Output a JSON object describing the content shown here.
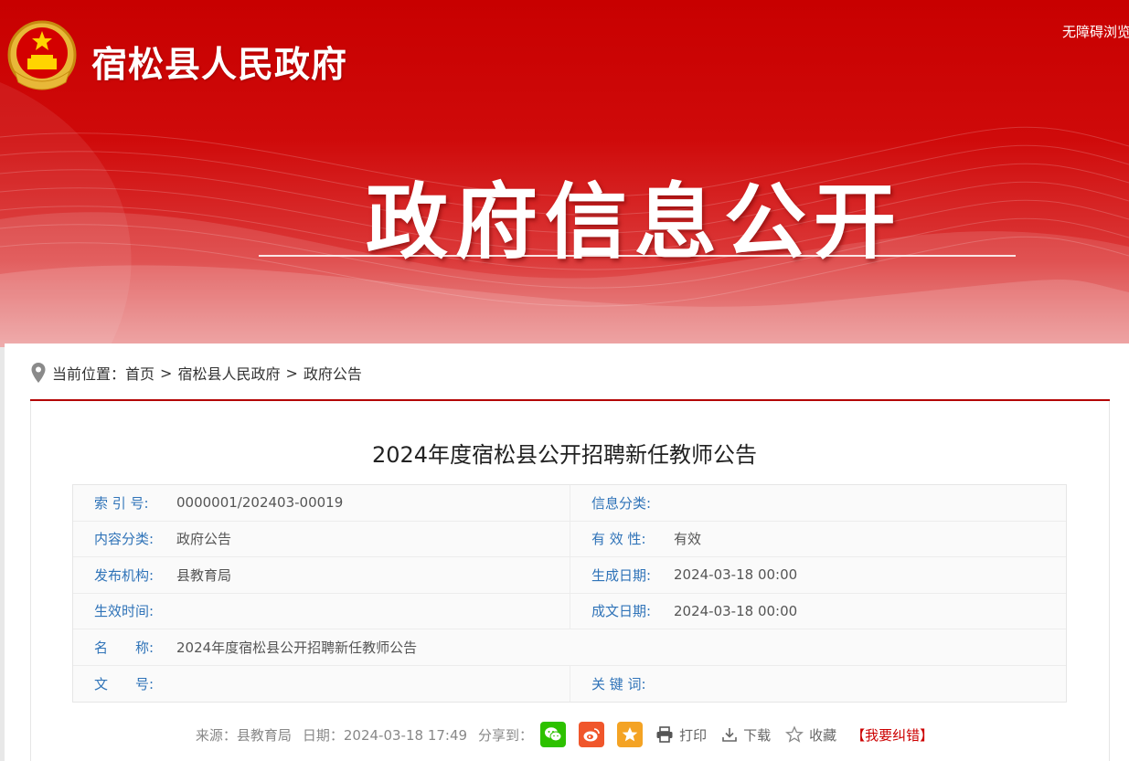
{
  "header": {
    "site_name": "宿松县人民政府",
    "accessibility_link": "无障碍浏览",
    "banner_title": "政府信息公开"
  },
  "breadcrumb": {
    "prefix": "当前位置：",
    "items": [
      "首页",
      "宿松县人民政府",
      "政府公告"
    ],
    "separator": ">"
  },
  "article": {
    "title": "2024年度宿松县公开招聘新任教师公告"
  },
  "info": {
    "index_label": "索 引 号:",
    "index_value": "0000001/202403-00019",
    "category_label": "信息分类:",
    "category_value": "",
    "content_type_label": "内容分类:",
    "content_type_value": "政府公告",
    "validity_label": "有 效 性:",
    "validity_value": "有效",
    "publisher_label": "发布机构:",
    "publisher_value": "县教育局",
    "created_label": "生成日期:",
    "created_value": "2024-03-18 00:00",
    "effective_label": "生效时间:",
    "effective_value": "",
    "written_label": "成文日期:",
    "written_value": "2024-03-18 00:00",
    "name_label": "名　　称:",
    "name_value": "2024年度宿松县公开招聘新任教师公告",
    "docno_label": "文　　号:",
    "docno_value": "",
    "keywords_label": "关 键 词:",
    "keywords_value": ""
  },
  "meta": {
    "source": "来源：县教育局",
    "date": "日期：2024-03-18 17:49",
    "share_label": "分享到：",
    "print_label": "打印",
    "download_label": "下载",
    "favorite_label": "收藏",
    "report_label": "【我要纠错】"
  },
  "colors": {
    "brand_red": "#c80000",
    "label_blue": "#2f73b8",
    "wechat_green": "#2dc100",
    "weibo_orange": "#f0562b",
    "qzone_orange": "#f4a324"
  },
  "icons": {
    "location": "location-pin-icon",
    "wechat": "wechat-icon",
    "weibo": "weibo-icon",
    "qzone": "qzone-star-icon",
    "print": "printer-icon",
    "download": "download-icon",
    "favorite": "star-outline-icon"
  }
}
